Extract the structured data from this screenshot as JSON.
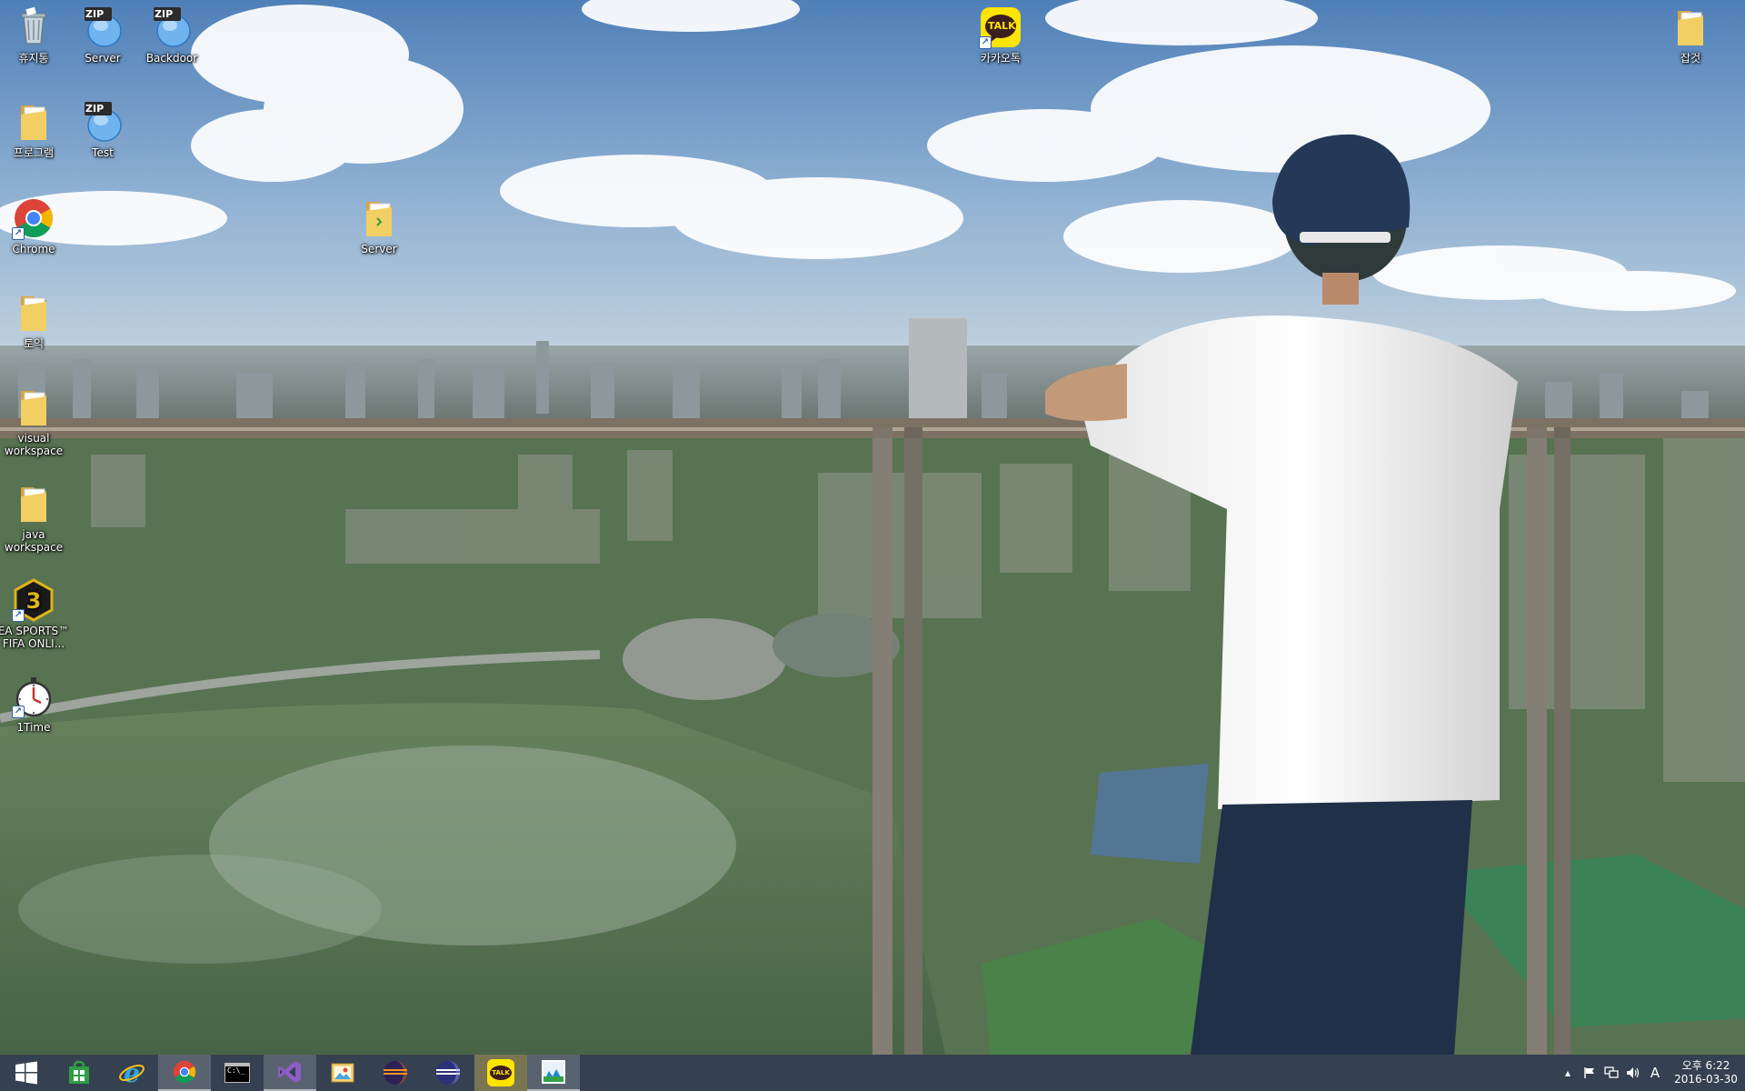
{
  "desktop": {
    "icons": [
      {
        "id": "recycle",
        "label": "휴지통",
        "icon": "recycle-bin-icon"
      },
      {
        "id": "server-zip",
        "label": "Server",
        "icon": "zip-archive-icon"
      },
      {
        "id": "backdoor-zip",
        "label": "Backdoor",
        "icon": "zip-archive-icon"
      },
      {
        "id": "kakaotalk",
        "label": "카카오톡",
        "icon": "kakaotalk-icon"
      },
      {
        "id": "gadget",
        "label": "잡것",
        "icon": "folder-icon"
      },
      {
        "id": "program",
        "label": "프로그램",
        "icon": "folder-icon"
      },
      {
        "id": "test-zip",
        "label": "Test",
        "icon": "zip-archive-icon"
      },
      {
        "id": "chrome",
        "label": "Chrome",
        "icon": "chrome-icon"
      },
      {
        "id": "server-folder",
        "label": "Server",
        "icon": "folder-icon"
      },
      {
        "id": "toeic",
        "label": "토익",
        "icon": "folder-icon"
      },
      {
        "id": "visual-ws",
        "label": "visual workspace",
        "icon": "folder-icon"
      },
      {
        "id": "java-ws",
        "label": "java workspace",
        "icon": "folder-icon"
      },
      {
        "id": "fifa",
        "label": "EA SPORTS™ FIFA ONLI...",
        "icon": "fifa-online-icon"
      },
      {
        "id": "itime",
        "label": "1Time",
        "icon": "stopwatch-icon"
      }
    ],
    "zip_badge": "ZIP",
    "kakao_badge": "TALK"
  },
  "taskbar": {
    "buttons": [
      {
        "id": "start",
        "icon": "windows-start-icon"
      },
      {
        "id": "store",
        "icon": "store-icon"
      },
      {
        "id": "ie",
        "icon": "internet-explorer-icon"
      },
      {
        "id": "chrome",
        "icon": "chrome-icon",
        "state": "active"
      },
      {
        "id": "cmd",
        "icon": "command-prompt-icon"
      },
      {
        "id": "visual-studio",
        "icon": "visual-studio-icon",
        "state": "active"
      },
      {
        "id": "paint",
        "icon": "image-viewer-icon"
      },
      {
        "id": "eclipse-1",
        "icon": "eclipse-icon"
      },
      {
        "id": "eclipse-2",
        "icon": "eclipse-icon"
      },
      {
        "id": "kakaotalk",
        "icon": "kakaotalk-icon",
        "state": "highlight"
      },
      {
        "id": "image-app",
        "icon": "photo-app-icon",
        "state": "active"
      }
    ],
    "cmd_text": "C:\\_",
    "kakao_badge": "TALK",
    "tray": {
      "ime_indicator": "A",
      "time": "오후 6:22",
      "date": "2016-03-30"
    }
  },
  "colors": {
    "taskbar": "#303a48",
    "folder": "#e8c84a",
    "kakao": "#fee500",
    "chrome_red": "#db4437",
    "chrome_green": "#0f9d58",
    "chrome_yellow": "#f4b400",
    "chrome_blue": "#4285f4"
  }
}
